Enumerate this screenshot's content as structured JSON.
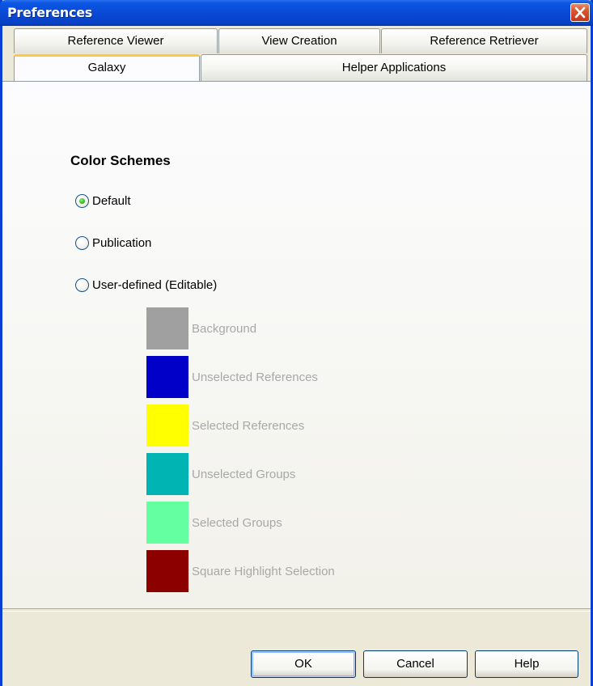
{
  "window": {
    "title": "Preferences"
  },
  "tabs": {
    "row1": [
      "Reference Viewer",
      "View Creation",
      "Reference Retriever"
    ],
    "row2": [
      "Galaxy",
      "Helper Applications"
    ],
    "active": "Galaxy"
  },
  "section": {
    "title": "Color Schemes"
  },
  "color_scheme_options": [
    {
      "label": "Default",
      "checked": true
    },
    {
      "label": "Publication",
      "checked": false
    },
    {
      "label": "User-defined (Editable)",
      "checked": false
    }
  ],
  "user_defined_colors": [
    {
      "label": "Background",
      "color": "#a0a0a0"
    },
    {
      "label": "Unselected References",
      "color": "#0000c8"
    },
    {
      "label": "Selected References",
      "color": "#ffff00"
    },
    {
      "label": "Unselected Groups",
      "color": "#00b4b4"
    },
    {
      "label": "Selected Groups",
      "color": "#64ffa0"
    },
    {
      "label": "Square Highlight Selection",
      "color": "#8c0000"
    }
  ],
  "buttons": {
    "ok": "OK",
    "cancel": "Cancel",
    "help": "Help"
  },
  "icons": {
    "close": "close-icon"
  }
}
